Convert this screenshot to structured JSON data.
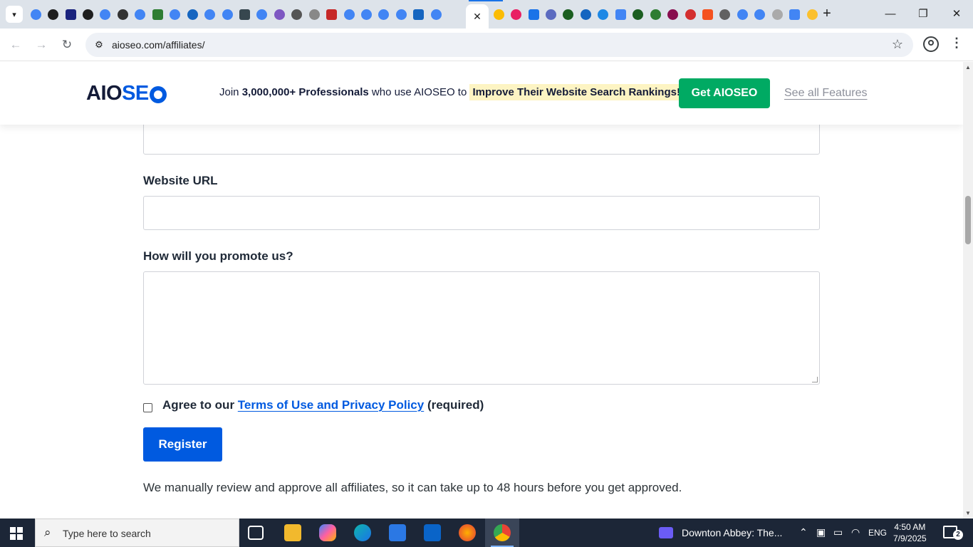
{
  "browser": {
    "url": "aioseo.com/affiliates/",
    "tabs_favicon_colors": [
      "#4285f4",
      "#1f1f1f",
      "#1a237e",
      "#1f1f1f",
      "#4285f4",
      "#333333",
      "#4285f4",
      "#2e7d32",
      "#4285f4",
      "#1565c0",
      "#4285f4",
      "#4285f4",
      "#37474f",
      "#4285f4",
      "#7e57c2",
      "#555555",
      "#888888",
      "#c62828",
      "#4285f4",
      "#4285f4",
      "#4285f4",
      "#4285f4",
      "#1565c0",
      "#4285f4"
    ],
    "tabs_after_active_colors": [
      "#fbbc04",
      "#e91e63",
      "#1a73e8",
      "#5c6bc0",
      "#1b5e20",
      "#1565c0",
      "#1e88e5",
      "#4285f4",
      "#1b5e20",
      "#2e7d32",
      "#880e4f",
      "#d32f2f",
      "#f4511e",
      "#616161",
      "#4285f4",
      "#4285f4",
      "#aaaaaa",
      "#4285f4",
      "#fbc02d"
    ],
    "active_tab_close": "✕",
    "new_tab": "+",
    "window_minimize": "—",
    "window_restore": "❐",
    "window_close": "✕"
  },
  "site": {
    "logo_dark": "AIO",
    "logo_blue": "SE",
    "promo_prefix": "Join ",
    "promo_count": "3,000,000+",
    "promo_professionals": " Professionals",
    "promo_middle": " who use AIOSEO to ",
    "promo_highlight": "Improve Their Website Search Rankings!",
    "cta_label": "Get AIOSEO",
    "features_label": "See all Features"
  },
  "form": {
    "website_label": "Website URL",
    "promote_label": "How will you promote us?",
    "agree_prefix": "Agree to our ",
    "agree_link": "Terms of Use and Privacy Policy",
    "agree_suffix": " (required)",
    "register_label": "Register",
    "note": "We manually review and approve all affiliates, so it can take up to 48 hours before you get approved."
  },
  "taskbar": {
    "search_placeholder": "Type here to search",
    "media_title": "Downton Abbey: The...",
    "language": "ENG",
    "time": "4:50 AM",
    "date": "7/9/2025",
    "notifications": "2"
  },
  "colors": {
    "brand_blue": "#005ae0",
    "cta_green": "#00aa63",
    "highlight": "#fdf4c3"
  }
}
